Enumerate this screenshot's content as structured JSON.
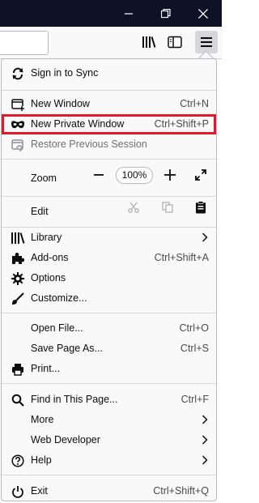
{
  "menu": {
    "sync": {
      "label": "Sign in to Sync",
      "icon": "sync-icon"
    },
    "new_window": {
      "label": "New Window",
      "shortcut": "Ctrl+N"
    },
    "new_private_window": {
      "label": "New Private Window",
      "shortcut": "Ctrl+Shift+P"
    },
    "restore_session": {
      "label": "Restore Previous Session"
    },
    "zoom": {
      "label": "Zoom",
      "value": "100%"
    },
    "edit": {
      "label": "Edit"
    },
    "library": {
      "label": "Library"
    },
    "addons": {
      "label": "Add-ons",
      "shortcut": "Ctrl+Shift+A"
    },
    "options": {
      "label": "Options"
    },
    "customize": {
      "label": "Customize..."
    },
    "open_file": {
      "label": "Open File...",
      "shortcut": "Ctrl+O"
    },
    "save_page": {
      "label": "Save Page As...",
      "shortcut": "Ctrl+S"
    },
    "print": {
      "label": "Print..."
    },
    "find": {
      "label": "Find in This Page...",
      "shortcut": "Ctrl+F"
    },
    "more": {
      "label": "More"
    },
    "web_developer": {
      "label": "Web Developer"
    },
    "help": {
      "label": "Help"
    },
    "exit": {
      "label": "Exit",
      "shortcut": "Ctrl+Shift+Q"
    }
  },
  "colors": {
    "titlebar": "#0f1226",
    "panel_bg": "#f9f9fa",
    "highlight_border": "#e0192c"
  }
}
